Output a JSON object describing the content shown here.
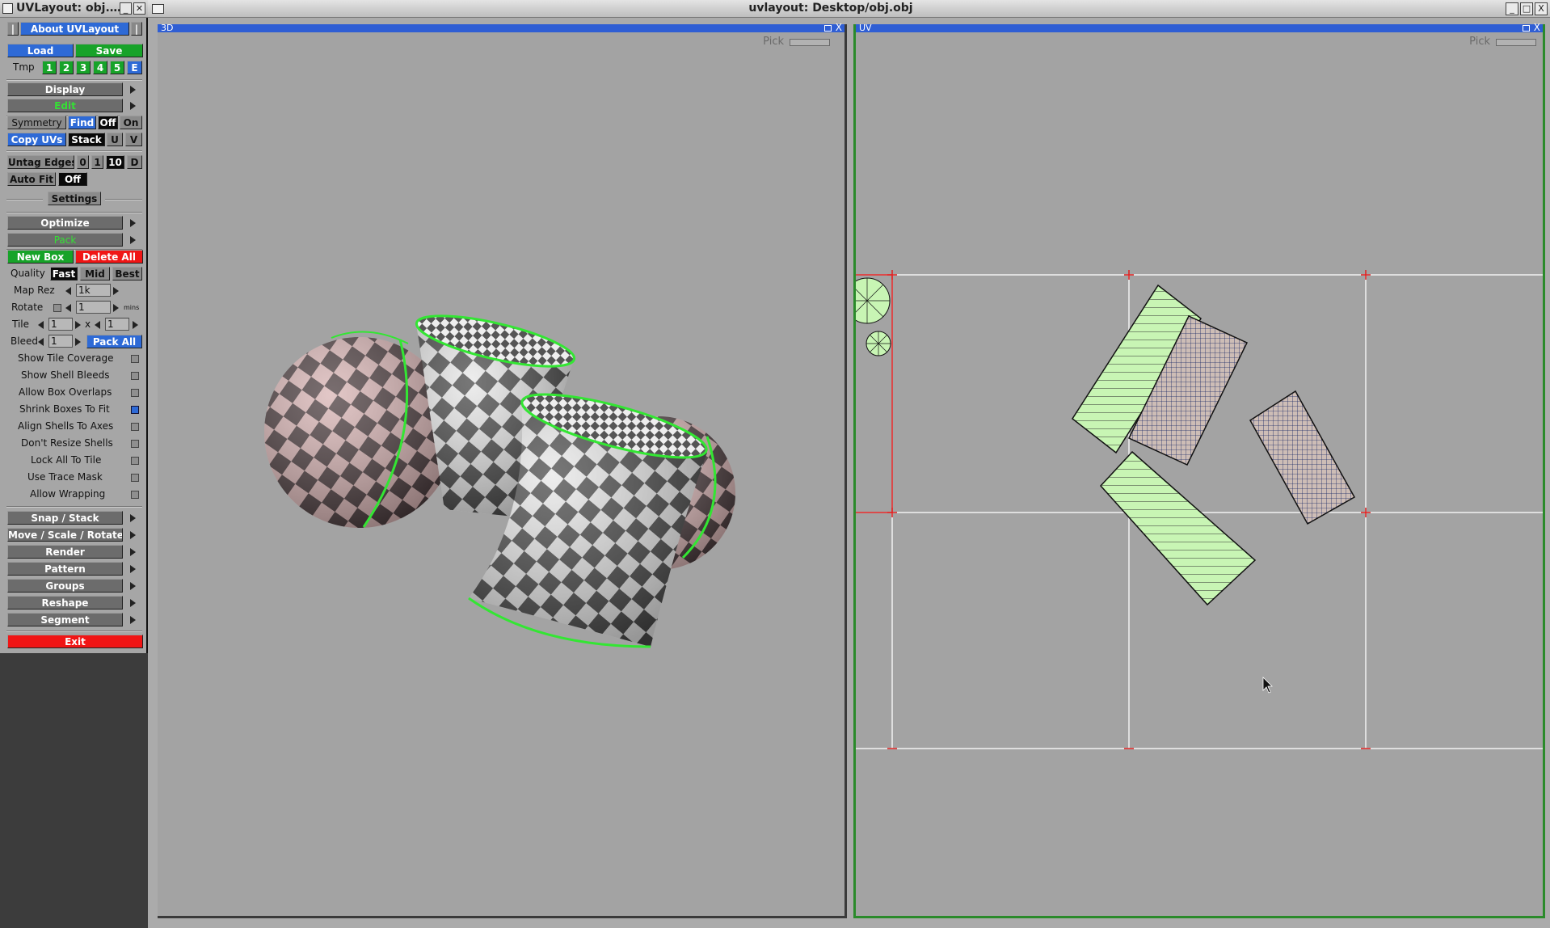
{
  "left_panel": {
    "title": "UVLayout: obj.…",
    "about": "About UVLayout",
    "load": "Load",
    "save": "Save",
    "tmp_label": "Tmp",
    "tmp_slots": [
      "1",
      "2",
      "3",
      "4",
      "5",
      "E"
    ],
    "display": "Display",
    "edit": "Edit",
    "symmetry": {
      "label": "Symmetry",
      "find": "Find",
      "off": "Off",
      "on": "On"
    },
    "copy_uvs": {
      "label": "Copy UVs",
      "stack": "Stack",
      "u": "U",
      "v": "V"
    },
    "untag_edges": {
      "label": "Untag Edges",
      "opts": [
        "0",
        "1",
        "10",
        "D"
      ]
    },
    "auto_fit": {
      "label": "Auto Fit",
      "value": "Off"
    },
    "settings": "Settings",
    "optimize": "Optimize",
    "pack": "Pack",
    "new_box": "New Box",
    "delete_all": "Delete All",
    "quality": {
      "label": "Quality",
      "fast": "Fast",
      "mid": "Mid",
      "best": "Best"
    },
    "map_rez": {
      "label": "Map Rez",
      "value": "1k"
    },
    "rotate": {
      "label": "Rotate",
      "value": "1",
      "unit": "mins"
    },
    "tile": {
      "label": "Tile",
      "x_value": "1",
      "x_sep": "x",
      "y_value": "1"
    },
    "bleed": {
      "label": "Bleed",
      "value": "1",
      "pack_all": "Pack All"
    },
    "options": [
      {
        "label": "Show Tile Coverage",
        "checked": false
      },
      {
        "label": "Show Shell Bleeds",
        "checked": false
      },
      {
        "label": "Allow Box Overlaps",
        "checked": false
      },
      {
        "label": "Shrink Boxes To Fit",
        "checked": true
      },
      {
        "label": "Align Shells To Axes",
        "checked": false
      },
      {
        "label": "Don't Resize Shells",
        "checked": false
      },
      {
        "label": "Lock All To Tile",
        "checked": false
      },
      {
        "label": "Use Trace Mask",
        "checked": false
      },
      {
        "label": "Allow Wrapping",
        "checked": false
      }
    ],
    "menus": [
      "Snap / Stack",
      "Move / Scale / Rotate",
      "Render",
      "Pattern",
      "Groups",
      "Reshape",
      "Segment"
    ],
    "exit": "Exit"
  },
  "main_window": {
    "title": "uvlayout: Desktop/obj.obj",
    "buttons": {
      "minimize": "_",
      "maximize": "□",
      "close": "X"
    }
  },
  "view_3d": {
    "name": "3D",
    "pick": "Pick",
    "close": "X"
  },
  "view_uv": {
    "name": "UV",
    "pick": "Pick",
    "close": "X"
  },
  "colors": {
    "accent_blue": "#2e6ad6",
    "green": "#17a329",
    "red": "#f01515",
    "shell_fill": "#c8f5b4",
    "seam_green": "#33e633",
    "viewport_bg": "#a3a3a3"
  }
}
